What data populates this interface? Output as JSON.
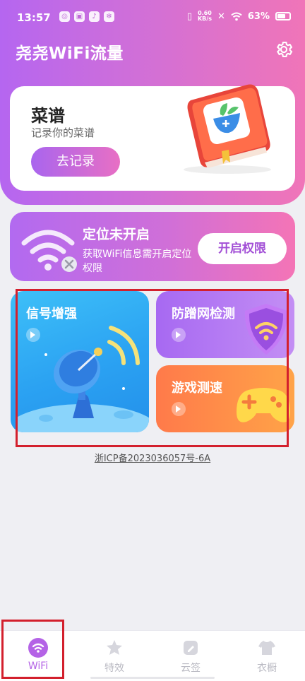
{
  "status_bar": {
    "time": "13:57",
    "net_speed_value": "0.60",
    "net_speed_unit": "KB/s",
    "battery": "63%"
  },
  "app": {
    "title": "尧尧WiFi流量"
  },
  "recipe_card": {
    "title": "菜谱",
    "subtitle": "记录你的菜谱",
    "button": "去记录"
  },
  "location_card": {
    "title": "定位未开启",
    "description": "获取WiFi信息需开启定位权限",
    "button": "开启权限"
  },
  "tools": {
    "signal_boost": "信号增强",
    "anti_leech": "防蹭网检测",
    "game_speed": "游戏测速"
  },
  "footer": {
    "icp": "浙ICP备2023036057号-6A"
  },
  "bottom_nav": {
    "items": [
      {
        "label": "WiFi",
        "icon": "wifi-icon",
        "active": true
      },
      {
        "label": "特效",
        "icon": "star-icon",
        "active": false
      },
      {
        "label": "云签",
        "icon": "pen-icon",
        "active": false
      },
      {
        "label": "衣橱",
        "icon": "shirt-icon",
        "active": false
      }
    ]
  },
  "colors": {
    "brand_start": "#b566f0",
    "brand_end": "#f075b8",
    "signal_card": "#2ba2f2",
    "anti_card": "#a769f2",
    "game_card": "#ff7a4a",
    "highlight": "#d3202d"
  }
}
